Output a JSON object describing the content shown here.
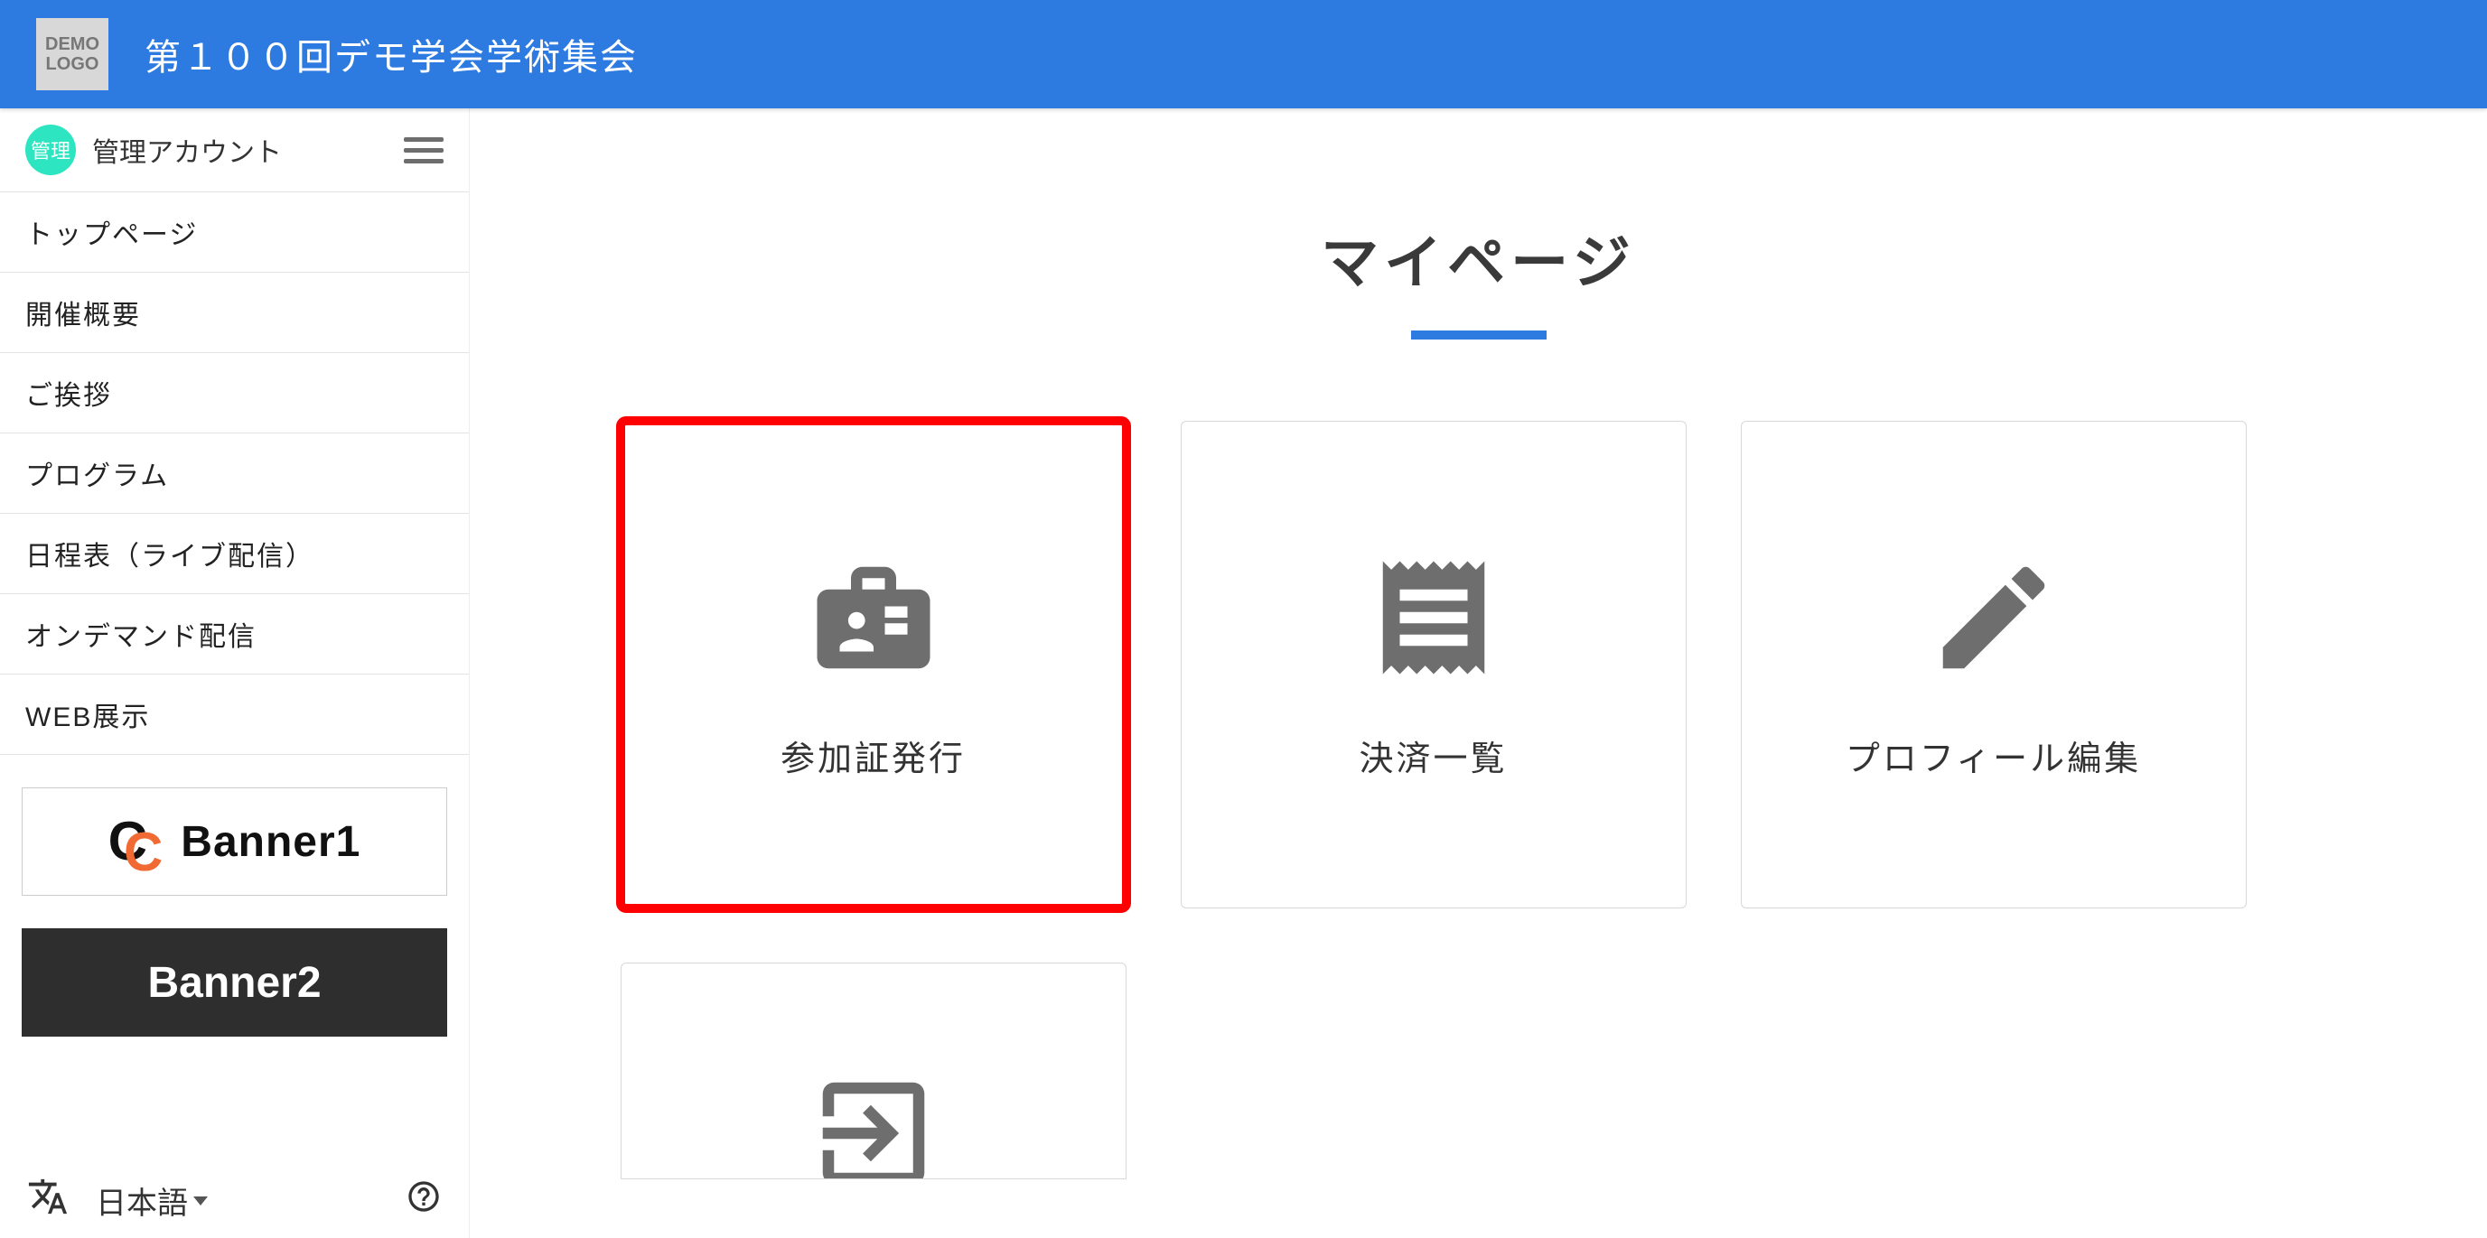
{
  "header": {
    "logo_line1": "DEMO",
    "logo_line2": "LOGO",
    "title": "第１００回デモ学会学術集会"
  },
  "sidebar": {
    "avatar_label": "管理",
    "user_name": "管理アカウント",
    "nav": [
      {
        "label": "トップページ"
      },
      {
        "label": "開催概要"
      },
      {
        "label": "ご挨拶"
      },
      {
        "label": "プログラム"
      },
      {
        "label": "日程表（ライブ配信）"
      },
      {
        "label": "オンデマンド配信"
      },
      {
        "label": "WEB展示"
      }
    ],
    "banners": {
      "banner1_label": "Banner1",
      "banner2_label": "Banner2"
    },
    "language_label": "日本語"
  },
  "main": {
    "page_title": "マイページ",
    "cards": [
      {
        "label": "参加証発行",
        "icon": "id-badge-icon",
        "highlight": true
      },
      {
        "label": "決済一覧",
        "icon": "receipt-icon",
        "highlight": false
      },
      {
        "label": "プロフィール編集",
        "icon": "pencil-icon",
        "highlight": false
      }
    ]
  }
}
